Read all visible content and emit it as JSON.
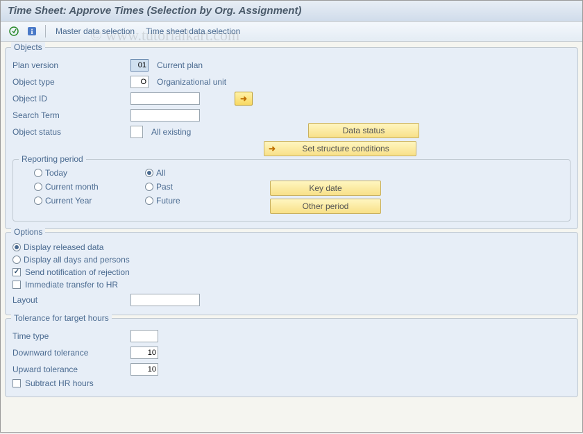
{
  "title": "Time Sheet: Approve Times (Selection by Org. Assignment)",
  "watermark": "© www.tutorialkart.com",
  "toolbar": {
    "master_data": "Master data selection",
    "time_sheet_data": "Time sheet data selection"
  },
  "objects": {
    "group_title": "Objects",
    "plan_version_label": "Plan version",
    "plan_version_value": "01",
    "plan_version_desc": "Current plan",
    "object_type_label": "Object type",
    "object_type_value": "O",
    "object_type_desc": "Organizational unit",
    "object_id_label": "Object ID",
    "object_id_value": "",
    "search_term_label": "Search Term",
    "search_term_value": "",
    "object_status_label": "Object status",
    "object_status_value": "",
    "object_status_desc": "All existing",
    "data_status_btn": "Data status",
    "set_structure_btn": "Set structure conditions"
  },
  "reporting": {
    "group_title": "Reporting period",
    "today": "Today",
    "current_month": "Current month",
    "current_year": "Current Year",
    "all": "All",
    "past": "Past",
    "future": "Future",
    "key_date_btn": "Key date",
    "other_period_btn": "Other period",
    "selected": "all"
  },
  "options": {
    "group_title": "Options",
    "display_released": "Display released data",
    "display_all": "Display all days and persons",
    "send_notification": "Send notification of rejection",
    "immediate_transfer": "Immediate transfer to HR",
    "layout_label": "Layout",
    "layout_value": "",
    "selected_radio": "released",
    "notification_checked": true,
    "transfer_checked": false
  },
  "tolerance": {
    "group_title": "Tolerance for target hours",
    "time_type_label": "Time type",
    "time_type_value": "",
    "downward_label": "Downward tolerance",
    "downward_value": "10",
    "upward_label": "Upward tolerance",
    "upward_value": "10",
    "subtract_label": "Subtract HR hours",
    "subtract_checked": false
  }
}
